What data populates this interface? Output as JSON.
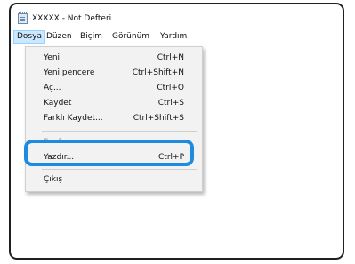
{
  "window": {
    "title": "XXXXX - Not Defteri",
    "icon": "notepad-icon"
  },
  "menubar": {
    "items": [
      "Dosya",
      "Düzen",
      "Biçim",
      "Görünüm",
      "Yardım"
    ]
  },
  "file_menu": {
    "items": [
      {
        "label": "Yeni",
        "shortcut": "Ctrl+N"
      },
      {
        "label": "Yeni pencere",
        "shortcut": "Ctrl+Shift+N"
      },
      {
        "label": "Aç...",
        "shortcut": "Ctrl+O"
      },
      {
        "label": "Kaydet",
        "shortcut": "Ctrl+S"
      },
      {
        "label": "Farklı Kaydet...",
        "shortcut": "Ctrl+Shift+S"
      },
      {
        "label": "Yazdır...",
        "shortcut": "Ctrl+P"
      },
      {
        "label": "Çıkış",
        "shortcut": ""
      }
    ],
    "partially_hidden_item": "Sayfa Yapısı..."
  },
  "colors": {
    "highlight": "#1d8be0",
    "menu_active_bg": "#cce8ff",
    "window_border": "#202020",
    "menu_bg": "#f2f2f2"
  }
}
